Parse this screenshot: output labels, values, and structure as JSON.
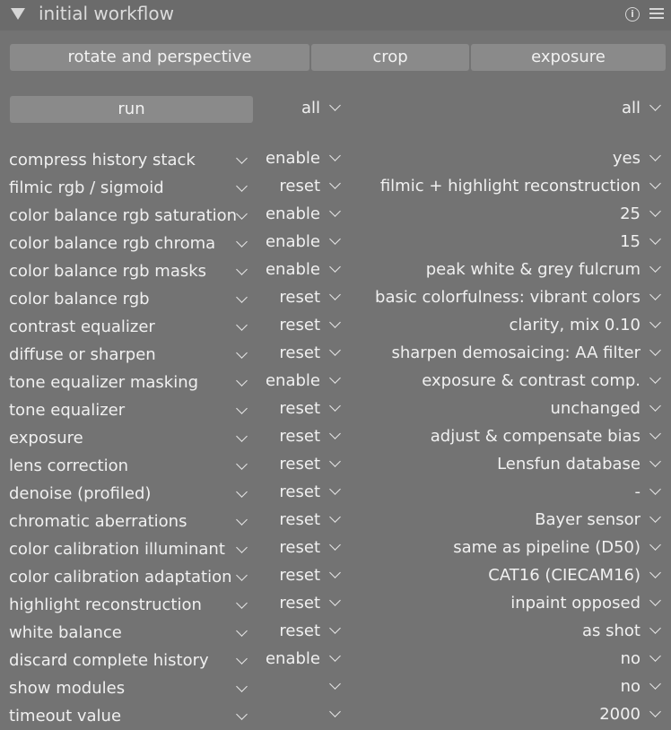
{
  "header": {
    "title": "initial workflow",
    "info_glyph": "i"
  },
  "top_buttons": [
    {
      "label": "rotate and perspective"
    },
    {
      "label": "crop"
    },
    {
      "label": "exposure"
    }
  ],
  "run_row": {
    "run_label": "run",
    "mid_label": "all",
    "right_label": "all"
  },
  "rows": [
    {
      "name": "compress history stack",
      "action": "enable",
      "value": "yes"
    },
    {
      "name": "filmic rgb / sigmoid",
      "action": "reset",
      "value": "filmic + highlight reconstruction"
    },
    {
      "name": "color balance rgb saturation",
      "action": "enable",
      "value": "25"
    },
    {
      "name": "color balance rgb chroma",
      "action": "enable",
      "value": "15"
    },
    {
      "name": "color balance rgb masks",
      "action": "enable",
      "value": "peak white & grey fulcrum"
    },
    {
      "name": "color balance rgb",
      "action": "reset",
      "value": "basic colorfulness: vibrant colors"
    },
    {
      "name": "contrast equalizer",
      "action": "reset",
      "value": "clarity, mix 0.10"
    },
    {
      "name": "diffuse or sharpen",
      "action": "reset",
      "value": "sharpen demosaicing: AA filter"
    },
    {
      "name": "tone equalizer masking",
      "action": "enable",
      "value": "exposure & contrast comp."
    },
    {
      "name": "tone equalizer",
      "action": "reset",
      "value": "unchanged"
    },
    {
      "name": "exposure",
      "action": "reset",
      "value": "adjust & compensate bias"
    },
    {
      "name": "lens correction",
      "action": "reset",
      "value": "Lensfun database"
    },
    {
      "name": "denoise (profiled)",
      "action": "reset",
      "value": "-"
    },
    {
      "name": "chromatic aberrations",
      "action": "reset",
      "value": "Bayer sensor"
    },
    {
      "name": "color calibration illuminant",
      "action": "reset",
      "value": "same as pipeline (D50)"
    },
    {
      "name": "color calibration adaptation",
      "action": "reset",
      "value": "CAT16 (CIECAM16)"
    },
    {
      "name": "highlight reconstruction",
      "action": "reset",
      "value": "inpaint opposed"
    },
    {
      "name": "white balance",
      "action": "reset",
      "value": "as shot"
    },
    {
      "name": "discard complete history",
      "action": "enable",
      "value": "no"
    },
    {
      "name": "show modules",
      "action": "",
      "value": "no"
    },
    {
      "name": "timeout value",
      "action": "",
      "value": "2000"
    }
  ]
}
